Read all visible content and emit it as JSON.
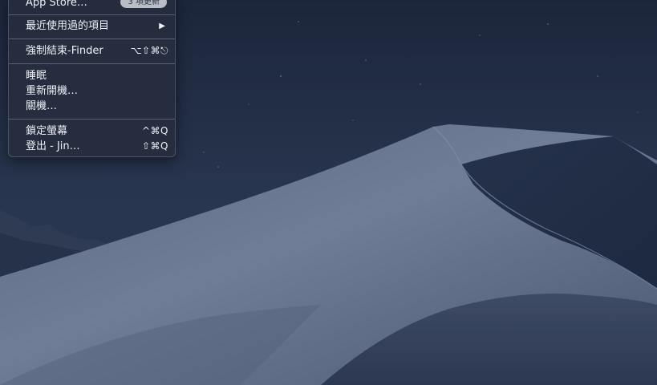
{
  "menu": {
    "app_store": {
      "label": "App Store…",
      "badge": "3 項更新"
    },
    "recent_items": {
      "label": "最近使用過的項目",
      "arrow": "▶"
    },
    "force_quit": {
      "label": "強制結束-Finder",
      "shortcut": "⌥⇧⌘⎋"
    },
    "sleep": {
      "label": "睡眠"
    },
    "restart": {
      "label": "重新開機…"
    },
    "shutdown": {
      "label": "關機…"
    },
    "lock_screen": {
      "label": "鎖定螢幕",
      "shortcut": "^⌘Q"
    },
    "log_out": {
      "label": "登出 - Jin…",
      "shortcut": "⇧⌘Q"
    }
  },
  "colors": {
    "menu_background": "#262d3e",
    "menu_text": "#eef1f6",
    "badge_background": "#b8bdc6",
    "sky": "#1f2c44"
  },
  "wallpaper": "mojave-dark-dunes"
}
